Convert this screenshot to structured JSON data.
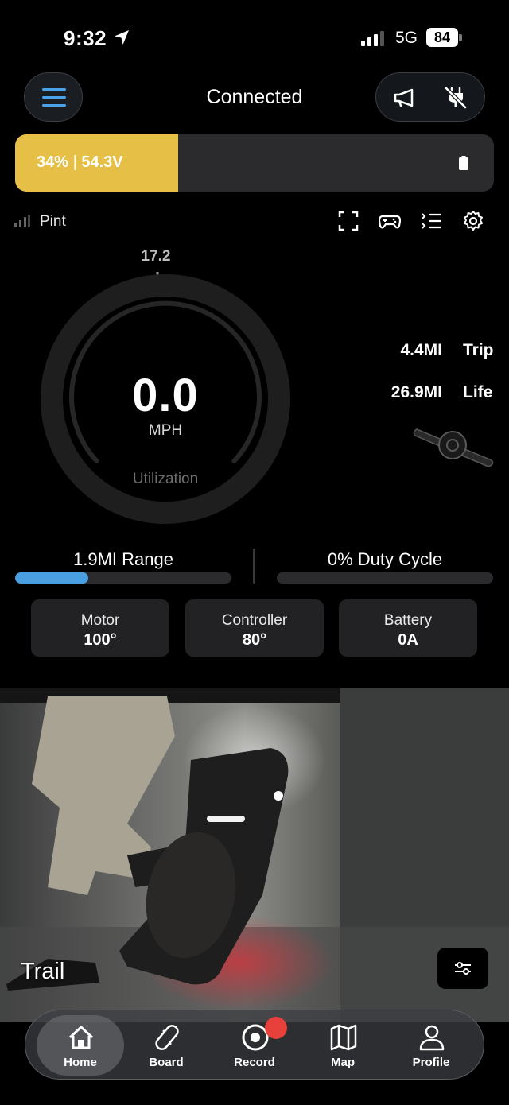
{
  "status_bar": {
    "time": "9:32",
    "network": "5G",
    "battery": "84"
  },
  "header": {
    "title": "Connected"
  },
  "battery_bar": {
    "percent_label": "34%",
    "voltage_label": "54.3V",
    "level": 0.34,
    "color": "#e6bf46"
  },
  "board": {
    "name": "Pint"
  },
  "gauge": {
    "max_label": "17.2",
    "speed": "0.0",
    "unit": "MPH",
    "utilization_label": "Utilization"
  },
  "stats": {
    "trip": {
      "value": "4.4MI",
      "label": "Trip"
    },
    "life": {
      "value": "26.9MI",
      "label": "Life"
    }
  },
  "range": {
    "label": "1.9MI Range",
    "level": 0.34,
    "color": "#4a9fe0"
  },
  "duty": {
    "label": "0% Duty Cycle",
    "level": 0
  },
  "temps": [
    {
      "label": "Motor",
      "value": "100°"
    },
    {
      "label": "Controller",
      "value": "80°"
    },
    {
      "label": "Battery",
      "value": "0A"
    }
  ],
  "ride_mode": {
    "label": "Trail"
  },
  "nav": {
    "items": [
      {
        "label": "Home",
        "icon": "home-icon",
        "active": true
      },
      {
        "label": "Board",
        "icon": "skateboard-icon",
        "active": false
      },
      {
        "label": "Record",
        "icon": "record-icon",
        "active": false
      },
      {
        "label": "Map",
        "icon": "map-icon",
        "active": false
      },
      {
        "label": "Profile",
        "icon": "profile-icon",
        "active": false
      }
    ]
  },
  "icons": {
    "menu": "hamburger-menu-icon",
    "horn": "megaphone-icon",
    "disconnect": "unplug-icon",
    "fullscreen": "fullscreen-icon",
    "controller": "gamepad-icon",
    "list": "list-icon",
    "settings": "gear-icon",
    "filter": "sliders-icon"
  }
}
